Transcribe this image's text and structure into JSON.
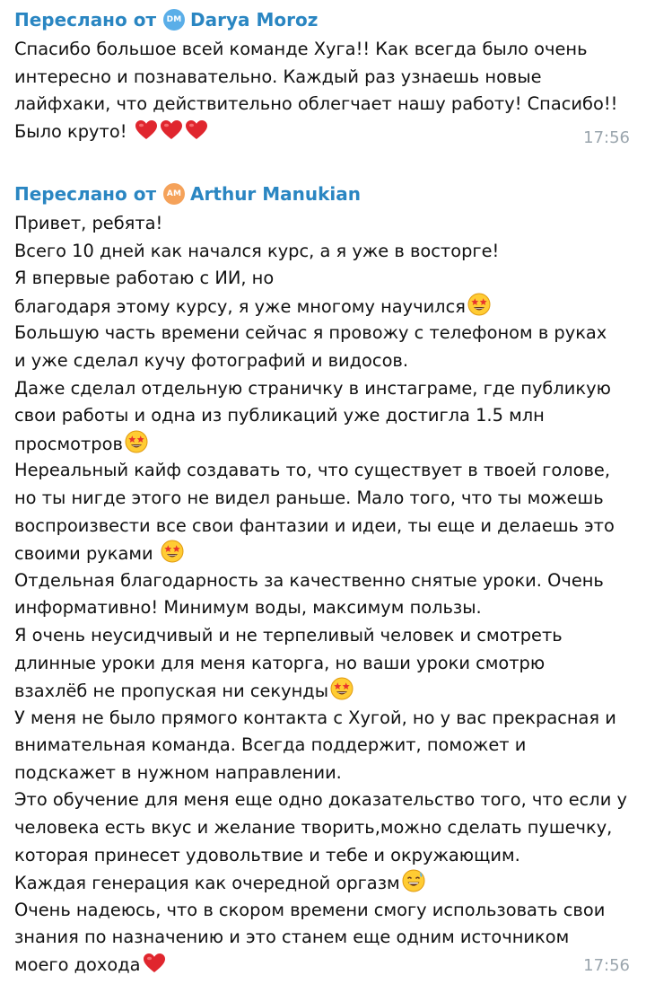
{
  "messages": [
    {
      "forward_label": "Переслано от",
      "author_initials": "DM",
      "author_name": "Darya Moroz",
      "lines": [
        "Спасибо большое всей команде Хуга!! Как всегда было очень",
        "интересно и познавательно. Каждый раз узнаешь новые",
        "лайфхаки, что действительно облегчает нашу работу! Спасибо!!",
        "Было круто!"
      ],
      "time": "17:56"
    },
    {
      "forward_label": "Переслано от",
      "author_initials": "AM",
      "author_name": "Arthur Manukian",
      "lines": [
        "Привет, ребята!",
        "Всего 10 дней как начался курс, а я уже в восторге!",
        "Я впервые работаю с ИИ, но",
        "благодаря этому курсу, я уже многому научился",
        "Большую часть времени сейчас я провожу с телефоном в руках",
        "и уже сделал кучу фотографий и видосов.",
        "Даже сделал отдельную страничку в инстаграме, где публикую",
        "свои работы и одна из публикаций уже достигла 1.5 млн",
        "просмотров",
        "Нереальный кайф создавать то, что существует в твоей голове,",
        "но ты нигде этого не видел раньше. Мало того, что ты можешь",
        "воспроизвести все свои фантазии и идеи, ты еще и делаешь это",
        "своими руками ",
        "Отдельная благодарность за качественно снятые уроки. Очень",
        "информативно! Минимум воды, максимум пользы.",
        "Я очень неусидчивый и не терпеливый человек и смотреть",
        "длинные уроки для меня каторга, но ваши уроки смотрю",
        "взахлёб не пропуская ни секунды",
        "У меня не было прямого контакта с Хугой, но у вас прекрасная и",
        "внимательная команда. Всегда поддержит, поможет и",
        "подскажет в нужном направлении.",
        "Это обучение для меня еще одно доказательство того, что если у",
        "человека есть вкус и желание  творить,можно сделать пушечку,",
        "которая принесет удовольтвие и тебе и окружающим.",
        "Каждая генерация как очередной оргазм",
        "Очень надеюсь, что в скором времени смогу использовать свои",
        "знания по назначению и это станем еще одним источником",
        "моего дохода"
      ],
      "time": "17:56"
    }
  ],
  "icons": {
    "heart": "red-heart-icon",
    "star_struck": "star-struck-emoji-icon",
    "grinning_sweat": "grinning-sweat-emoji-icon"
  },
  "colors": {
    "forward_header": "#2a86c2",
    "timestamp": "#9aa5ad",
    "avatar_dm": "#5aaee8",
    "avatar_am": "#f5a25a",
    "heart": "#e0262e",
    "emoji_face": "#ffcc33"
  }
}
